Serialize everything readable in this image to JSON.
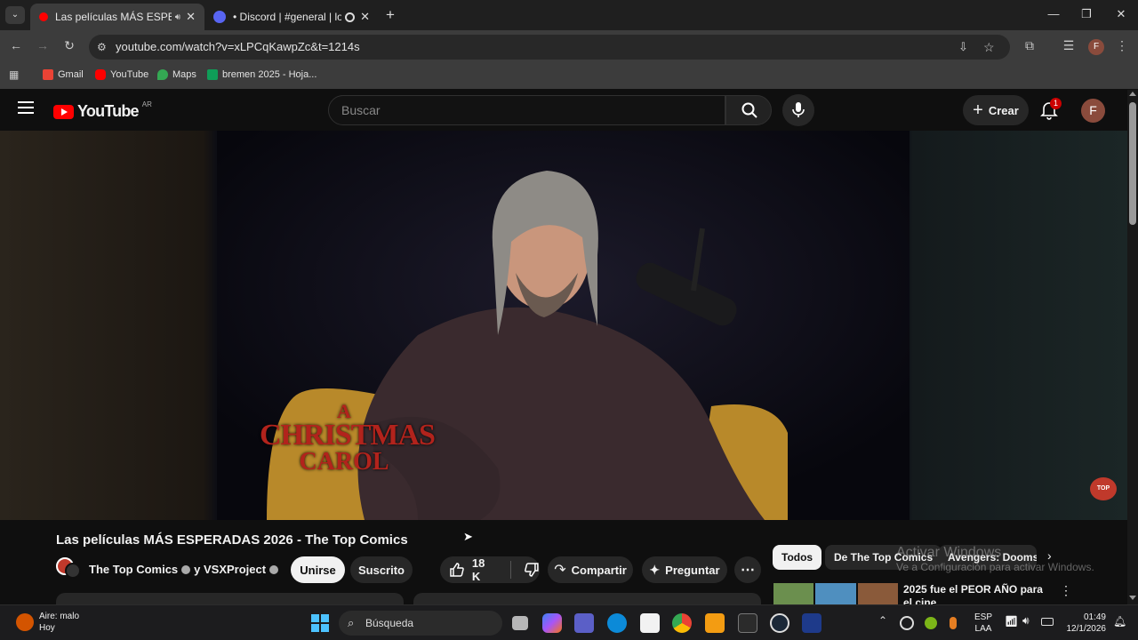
{
  "browser": {
    "tabs": [
      {
        "title": "Las películas MÁS ESPERAD",
        "active": true,
        "favicon_color": "#ff0000"
      },
      {
        "title": "• Discord | #general | los co",
        "active": false,
        "favicon_color": "#5865f2"
      }
    ],
    "url": "youtube.com/watch?v=xLPCqKawpZc&t=1214s",
    "bookmarks": [
      {
        "label": "Gmail",
        "color": "#ea4335"
      },
      {
        "label": "YouTube",
        "color": "#ff0000"
      },
      {
        "label": "Maps",
        "color": "#34a853"
      },
      {
        "label": "bremen 2025 - Hoja...",
        "color": "#0f9d58"
      }
    ]
  },
  "youtube": {
    "logo_text": "YouTube",
    "country": "AR",
    "search_placeholder": "Buscar",
    "create_label": "Crear",
    "notifications_count": "1",
    "avatar_letter": "F",
    "video_overlay_title": [
      "A",
      "CHRISTMAS",
      "CAROL"
    ],
    "video_title": "Las películas MÁS ESPERADAS 2026 - The Top Comics",
    "channel": "The Top Comics",
    "collab": "y VSXProject",
    "join_label": "Unirse",
    "subscribed_label": "Suscrito",
    "likes": "18 K",
    "share_label": "Compartir",
    "ask_label": "Preguntar",
    "chips": [
      "Todos",
      "De The Top Comics",
      "Avengers: Dooms"
    ],
    "recommendation_title": "2025 fue el PEOR AÑO para el cine",
    "watermark_line1": "Activar Windows",
    "watermark_line2": "Ve a Configuración para activar Windows."
  },
  "taskbar": {
    "weather_title": "Aire: malo",
    "weather_sub": "Hoy",
    "search_label": "Búsqueda",
    "lang_top": "ESP",
    "lang_bottom": "LAA",
    "time": "01:49",
    "date": "12/1/2026"
  },
  "colors": {
    "accent": "#ff0000",
    "background": "#0f0f0f"
  }
}
